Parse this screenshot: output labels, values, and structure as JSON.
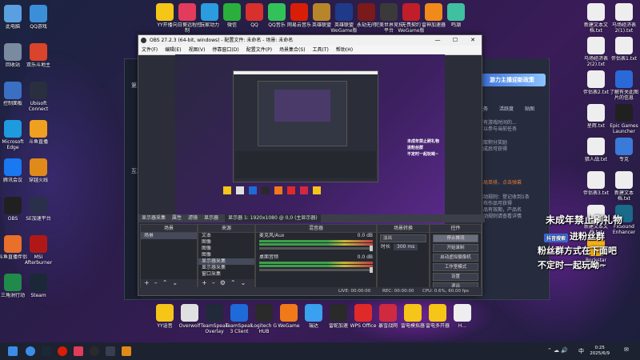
{
  "desktop": {
    "left_icons": [
      {
        "label": "此电脑",
        "color": "#5aa0e0"
      },
      {
        "label": "QQ游戏",
        "color": "#3b8fd9"
      },
      {
        "label": "回收站",
        "color": "#7a8aa0"
      },
      {
        "label": "双乐斗地主",
        "color": "#d9442a"
      },
      {
        "label": "控制面板",
        "color": "#3a6fc4"
      },
      {
        "label": "Ubisoft Connect",
        "color": "#2a2f3f"
      },
      {
        "label": "Microsoft Edge",
        "color": "#1e9adf"
      },
      {
        "label": "斗鱼直播",
        "color": "#f0a020"
      },
      {
        "label": "腾讯会议",
        "color": "#1a78f0"
      },
      {
        "label": "穿越火线",
        "color": "#e08a1a"
      },
      {
        "label": "OBS",
        "color": "#202020"
      },
      {
        "label": "SE加速平台",
        "color": "#2a2f4a"
      },
      {
        "label": "斗鱼直播伴侣",
        "color": "#e8702a"
      },
      {
        "label": "MSI Afterburner",
        "color": "#b01818"
      },
      {
        "label": "三角洲行动",
        "color": "#1f8a4a"
      },
      {
        "label": "Steam",
        "color": "#1b2838"
      }
    ],
    "top_icons": [
      {
        "label": "YY开播",
        "color": "#f5c518"
      },
      {
        "label": "向日葵远程控制",
        "color": "#e23b5c"
      },
      {
        "label": "玩家动力",
        "color": "#2a9cdf"
      },
      {
        "label": "微信",
        "color": "#2aae3c"
      },
      {
        "label": "QQ",
        "color": "#d8302c"
      },
      {
        "label": "QQ音乐",
        "color": "#32c25a"
      },
      {
        "label": "网易云音乐",
        "color": "#d81e06"
      },
      {
        "label": "英雄联盟",
        "color": "#b8862a"
      },
      {
        "label": "英雄联盟WeGame版",
        "color": "#203a8a"
      },
      {
        "label": "永劫无间",
        "color": "#7a1a1a"
      },
      {
        "label": "完美世界竞技平台",
        "color": "#3a3a3a"
      },
      {
        "label": "无畏契约WeGame版",
        "color": "#c01f2a"
      },
      {
        "label": "雷神加速器",
        "color": "#f08a1a"
      },
      {
        "label": "鸣潮",
        "color": "#3fc0a0"
      }
    ],
    "right_icons": [
      {
        "label": "新建文本文档.txt",
        "color": "#eeeeee"
      },
      {
        "label": "马场经济表2(1).txt",
        "color": "#eeeeee"
      },
      {
        "label": "马场经济表2(2).txt",
        "color": "#eeeeee"
      },
      {
        "label": "伴侣表1.txt",
        "color": "#eeeeee"
      },
      {
        "label": "伴侣表2.txt",
        "color": "#eeeeee"
      },
      {
        "label": "了解有关此图片的信息",
        "color": "#2a6ad8"
      },
      {
        "label": "星辉.txt",
        "color": "#eeeeee"
      },
      {
        "label": "Epic Games Launcher",
        "color": "#202020"
      },
      {
        "label": "猎人战.txt",
        "color": "#eeeeee"
      },
      {
        "label": "专克",
        "color": "#3a7ad8"
      },
      {
        "label": "伴侣表3.txt",
        "color": "#eeeeee"
      },
      {
        "label": "新建文本档.txt",
        "color": "#eeeeee"
      },
      {
        "label": "新建文本文档.txt",
        "color": "#eeeeee"
      },
      {
        "label": "FxSound Enhancer",
        "color": "#1a6a8a"
      },
      {
        "label": "Rockstar Games",
        "color": "#f5b21a"
      }
    ],
    "bottom_icons": [
      {
        "label": "YY语音",
        "color": "#f5c518"
      },
      {
        "label": "Overwolf",
        "color": "#e0e0e0"
      },
      {
        "label": "TeamSpeak Overlay",
        "color": "#202a3a"
      },
      {
        "label": "TeamSpeak 3 Client",
        "color": "#1e6ad8"
      },
      {
        "label": "Logitech G HUB",
        "color": "#2a2a2a"
      },
      {
        "label": "WeGame",
        "color": "#f07a1a"
      },
      {
        "label": "瑞达",
        "color": "#3aa0f0"
      },
      {
        "label": "雷蛇加速",
        "color": "#2a2a2a"
      },
      {
        "label": "WPS Office",
        "color": "#e02a2a"
      },
      {
        "label": "暴雪战网",
        "color": "#d02a40"
      },
      {
        "label": "雷电模拟器",
        "color": "#f5c518"
      },
      {
        "label": "雷电多开器",
        "color": "#f5c518"
      },
      {
        "label": "H...",
        "color": "#eeeeee"
      }
    ]
  },
  "bg_app": {
    "banner": "游力主播迎新政策",
    "tabs": [
      "任务",
      "活跃度",
      "贴图"
    ],
    "lines": [
      "所有游戏时间的...",
      "可以参与当前任务",
      "赢取积分奖励",
      "完成后可获得",
      "点击查看更多",
      "活动说明及规则",
      "三局单排，点击弹幕",
      "活动规则：登记收到1条",
      "发布作品可获得",
      "产品有效期，产品名",
      "称：风之旋",
      "活动规则请查看详情"
    ]
  },
  "obs": {
    "title": "OBS 27.2.3 (64-bit, windows) - 配置文件: 未命名 - 场景: 未命名",
    "menu": [
      "文件(F)",
      "编辑(E)",
      "视图(V)",
      "停靠窗口(D)",
      "配置文件(P)",
      "场景集合(S)",
      "工具(T)",
      "帮助(H)"
    ],
    "source_bar": [
      "显示器采集",
      "属性",
      "滤镜",
      "显示器",
      "显示器 1: 1920x1080 @ 0,0 (主显示器)"
    ],
    "docks": {
      "scenes": {
        "title": "场景",
        "items": [
          "场景"
        ]
      },
      "sources": {
        "title": "来源",
        "items": [
          "文本",
          "图像",
          "图像",
          "图像",
          "显示器采集",
          "显示器采集",
          "窗口采集"
        ]
      },
      "mixer": {
        "title": "混音器",
        "channels": [
          {
            "name": "麦克风/Aux",
            "db": "0.0 dB"
          },
          {
            "name": "桌面音频",
            "db": "0.0 dB"
          }
        ]
      },
      "transitions": {
        "title": "场景转换",
        "type": "淡出",
        "duration_label": "时长",
        "duration": "300 ms"
      },
      "controls": {
        "title": "控件",
        "buttons": [
          "停止推流",
          "开始录制",
          "启动虚拟摄像机",
          "工作室模式",
          "设置",
          "退出"
        ]
      }
    },
    "status": {
      "live": "LIVE: 00:00:00",
      "rec": "REC: 00:00:00",
      "cpu": "CPU: 0.6%, 60.00 fps"
    }
  },
  "promo": {
    "line1": "未成年禁止刷礼物",
    "line2": "进粉丝群",
    "line3": "粉丝群方式在下面吧",
    "line4": "不定时一起玩呦~",
    "tag": "抖音搜索"
  },
  "taskbar": {
    "time": "0:25",
    "date": "2025/6/9",
    "lang": "中"
  }
}
